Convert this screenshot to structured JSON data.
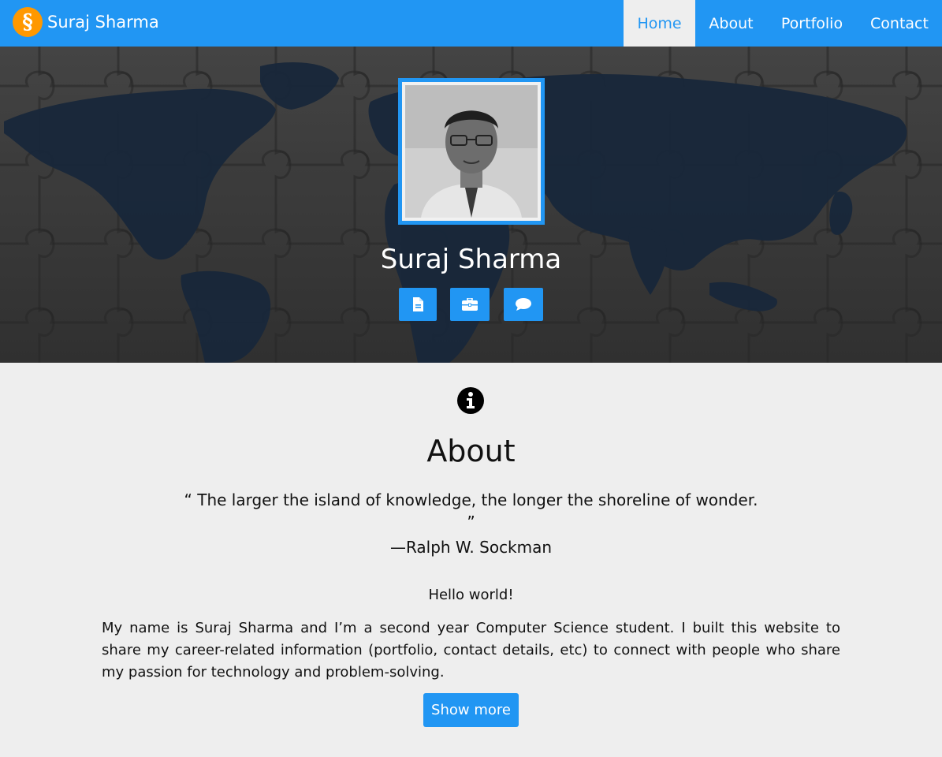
{
  "navbar": {
    "logo_glyph": "§",
    "brand_name": "Suraj Sharma",
    "items": [
      {
        "label": "Home",
        "active": true
      },
      {
        "label": "About",
        "active": false
      },
      {
        "label": "Portfolio",
        "active": false
      },
      {
        "label": "Contact",
        "active": false
      }
    ]
  },
  "hero": {
    "name": "Suraj Sharma",
    "buttons": [
      {
        "icon": "document-icon"
      },
      {
        "icon": "briefcase-icon"
      },
      {
        "icon": "chat-icon"
      }
    ]
  },
  "about": {
    "icon": "info-icon",
    "title": "About",
    "quote_line1": "“ The larger the island of knowledge, the longer the shoreline of wonder.",
    "quote_line2": "”",
    "quote_author": "—Ralph W. Sockman",
    "greeting": "Hello world!",
    "bio": "My name is Suraj Sharma and I’m a second year Computer Science student. I built this website to share my career-related information (portfolio, contact details, etc) to connect with people who share my passion for technology and problem-solving.",
    "show_more_label": "Show more"
  },
  "colors": {
    "primary": "#2196f3",
    "logo": "#ff9800",
    "page_background": "#eeeeee",
    "hero_overlay": "#3f3f3f",
    "map_water": "#1b2b3f"
  }
}
